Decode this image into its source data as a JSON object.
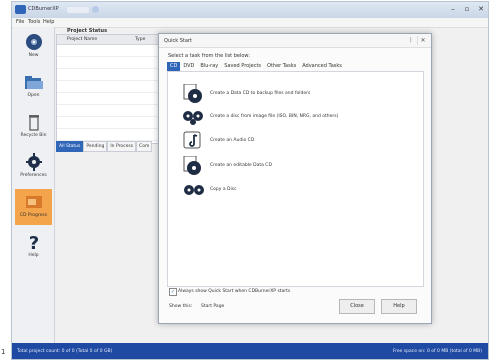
{
  "window": {
    "title": "CDBurnerXP"
  },
  "menu": [
    "File",
    "Tools",
    "Help"
  ],
  "sidebar": [
    {
      "label": "New",
      "icon": "disc-icon"
    },
    {
      "label": "Open",
      "icon": "folder-open-icon"
    },
    {
      "label": "Recycle Bin",
      "icon": "trash-icon"
    },
    {
      "label": "Preferences",
      "icon": "gear-icon"
    },
    {
      "label": "CD Progress",
      "icon": "progress-icon"
    },
    {
      "label": "Help",
      "icon": "question-icon"
    }
  ],
  "project_list": {
    "title": "Project Status",
    "columns": [
      "Project Name",
      "Type"
    ]
  },
  "filter_tabs": [
    "All Status",
    "Pending",
    "In Process",
    "Com"
  ],
  "status": {
    "left": "Total project count: 0 of 0 (Total 0 of 0 GB)",
    "right": "Free space on: 0 of 0 MB (total of 0 MB)"
  },
  "dialog": {
    "title": "Quick Start",
    "heading": "Select a task from the list below:",
    "tabs": [
      "CD",
      "DVD",
      "Blu-ray",
      "Saved Projects",
      "Other Tasks",
      "Advanced Tasks"
    ],
    "active_tab": "CD",
    "tasks": [
      {
        "label": "Create a Data CD to backup files and folders",
        "icon": "data-disc-icon"
      },
      {
        "label": "Create a disc from image file (ISO, BIN, NRG, and others)",
        "icon": "iso-image-icon"
      },
      {
        "label": "Create an Audio CD",
        "icon": "audio-cd-icon"
      },
      {
        "label": "Create an editable Data CD",
        "icon": "disc-copy-icon"
      },
      {
        "label": "Copy a Disc",
        "icon": "copy-disc-icon"
      }
    ],
    "checkbox_label": "Always show Quick Start when CDBurnerXP starts",
    "bottom_label": "Show this:",
    "bottom_link": "Start Page",
    "buttons": {
      "ok": "Close",
      "help": "Help"
    }
  },
  "colors": {
    "accent": "#2f66b8",
    "status_bar": "#1f4aa3",
    "active_sidebar": "#f4a44a"
  }
}
